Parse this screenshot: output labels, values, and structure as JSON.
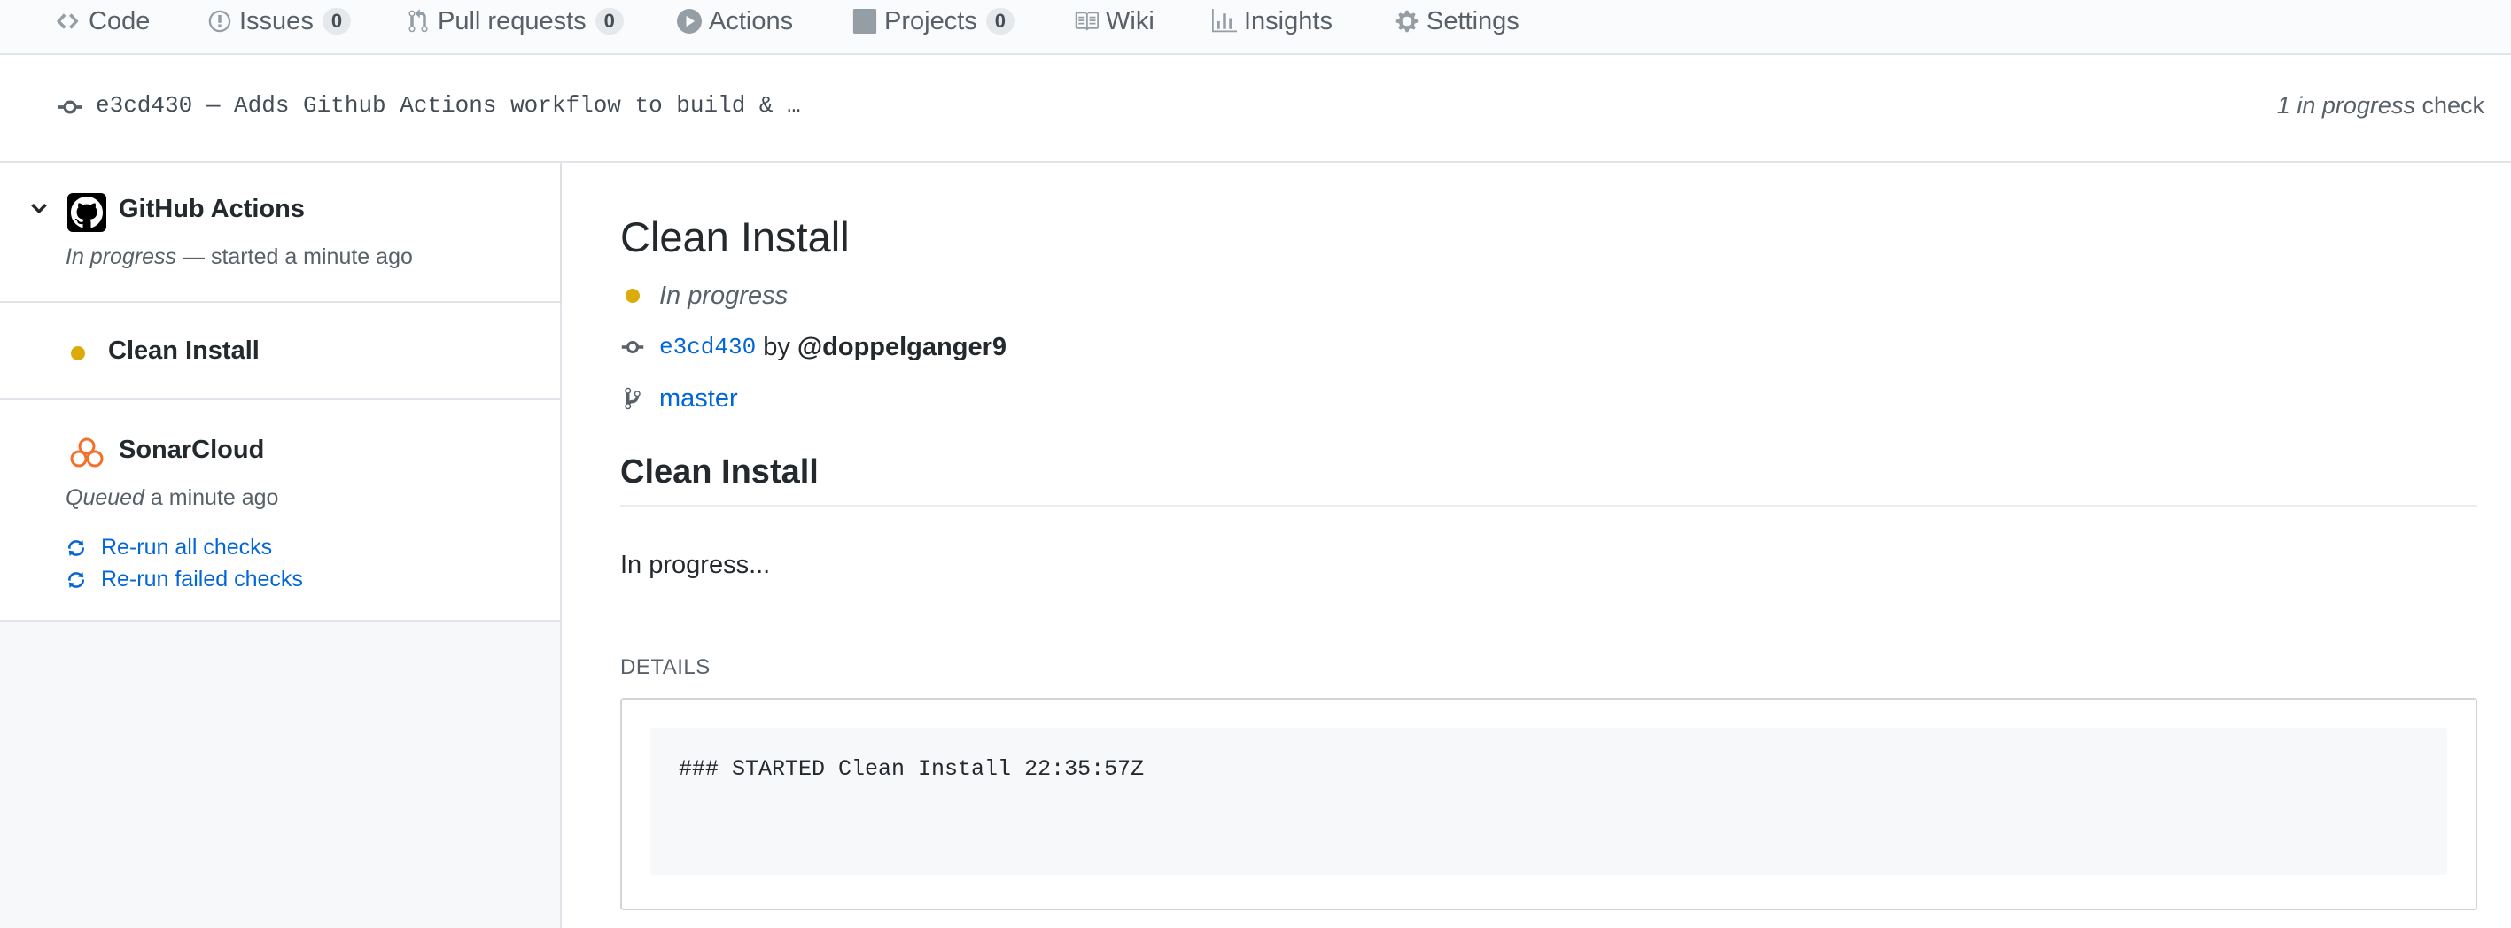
{
  "nav": {
    "items": [
      {
        "label": "Code",
        "icon": "code-icon"
      },
      {
        "label": "Issues",
        "icon": "issue-icon",
        "count": "0"
      },
      {
        "label": "Pull requests",
        "icon": "pull-request-icon",
        "count": "0"
      },
      {
        "label": "Actions",
        "icon": "play-icon"
      },
      {
        "label": "Projects",
        "icon": "project-icon",
        "count": "0"
      },
      {
        "label": "Wiki",
        "icon": "book-icon"
      },
      {
        "label": "Insights",
        "icon": "graph-icon"
      },
      {
        "label": "Settings",
        "icon": "gear-icon"
      }
    ]
  },
  "commit": {
    "message": "e3cd430 — Adds Github Actions workflow to build & …",
    "check_count_italic": "1 in progress",
    "check_count_suffix": " check"
  },
  "sidebar": {
    "github_actions": {
      "name": "GitHub Actions",
      "status_italic": "In progress",
      "status_suffix": " — started a minute ago"
    },
    "runs": [
      {
        "name": "Clean Install",
        "status_color": "#dbab09"
      }
    ],
    "sonarcloud": {
      "name": "SonarCloud",
      "status_italic": "Queued",
      "status_suffix": " a minute ago",
      "rerun_all": "Re-run all checks",
      "rerun_failed": "Re-run failed checks"
    }
  },
  "main": {
    "title": "Clean Install",
    "status": "In progress",
    "sha": "e3cd430",
    "by": "by",
    "author": "@doppelganger9",
    "branch": "master",
    "summary_heading": "Clean Install",
    "summary_text": "In progress...",
    "details_label": "DETAILS",
    "details_log": "### STARTED Clean Install 22:35:57Z"
  },
  "colors": {
    "accent": "#0366d6",
    "in_progress": "#dbab09",
    "sonar": "#f3702a"
  }
}
